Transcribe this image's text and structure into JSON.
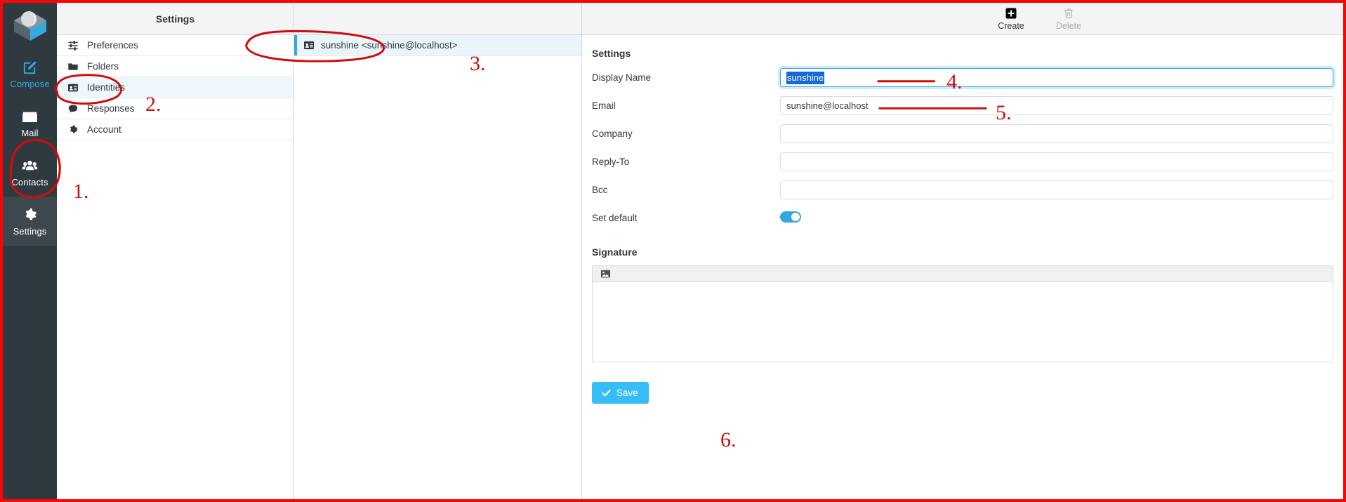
{
  "taskbar": {
    "logo_name": "roundcube-logo",
    "items": [
      {
        "label": "Compose",
        "icon": "compose-pencil-icon",
        "state": "accent"
      },
      {
        "label": "Mail",
        "icon": "envelope-icon",
        "state": "normal"
      },
      {
        "label": "Contacts",
        "icon": "contacts-people-icon",
        "state": "normal"
      },
      {
        "label": "Settings",
        "icon": "gear-icon",
        "state": "selected"
      }
    ]
  },
  "settings_panel": {
    "header": "Settings",
    "items": [
      {
        "label": "Preferences",
        "icon": "sliders-icon",
        "selected": false
      },
      {
        "label": "Folders",
        "icon": "folder-icon",
        "selected": false
      },
      {
        "label": "Identities",
        "icon": "identity-card-icon",
        "selected": true
      },
      {
        "label": "Responses",
        "icon": "speech-bubble-icon",
        "selected": false
      },
      {
        "label": "Account",
        "icon": "gear-icon",
        "selected": false
      }
    ]
  },
  "identities_panel": {
    "header": "",
    "items": [
      {
        "label": "sunshine <sunshine@localhost>",
        "icon": "identity-card-icon",
        "selected": true
      }
    ]
  },
  "toolbar": {
    "create_label": "Create",
    "create_icon": "plus-square-icon",
    "delete_label": "Delete",
    "delete_icon": "trash-icon",
    "delete_disabled": true
  },
  "form": {
    "section_title": "Settings",
    "fields": [
      {
        "label": "Display Name",
        "value": "sunshine",
        "placeholder": "",
        "focused": true,
        "selected_text": "sunshine"
      },
      {
        "label": "Email",
        "value": "sunshine@localhost",
        "placeholder": "",
        "focused": false
      },
      {
        "label": "Company",
        "value": "",
        "placeholder": "",
        "focused": false
      },
      {
        "label": "Reply-To",
        "value": "",
        "placeholder": "",
        "focused": false
      },
      {
        "label": "Bcc",
        "value": "",
        "placeholder": "",
        "focused": false
      }
    ],
    "set_default": {
      "label": "Set default",
      "on": true
    },
    "signature": {
      "title": "Signature",
      "toolbar_icon": "insert-image-icon",
      "content": ""
    },
    "save": {
      "label": "Save",
      "icon": "check-icon"
    }
  },
  "annotations": {
    "colors": {
      "mark": "#cf0b0b",
      "frame": "#f50808"
    },
    "numbers": [
      {
        "id": "1",
        "text": "1."
      },
      {
        "id": "2",
        "text": "2."
      },
      {
        "id": "3",
        "text": "3."
      },
      {
        "id": "4",
        "text": "4."
      },
      {
        "id": "5",
        "text": "5."
      },
      {
        "id": "6",
        "text": "6."
      }
    ]
  }
}
